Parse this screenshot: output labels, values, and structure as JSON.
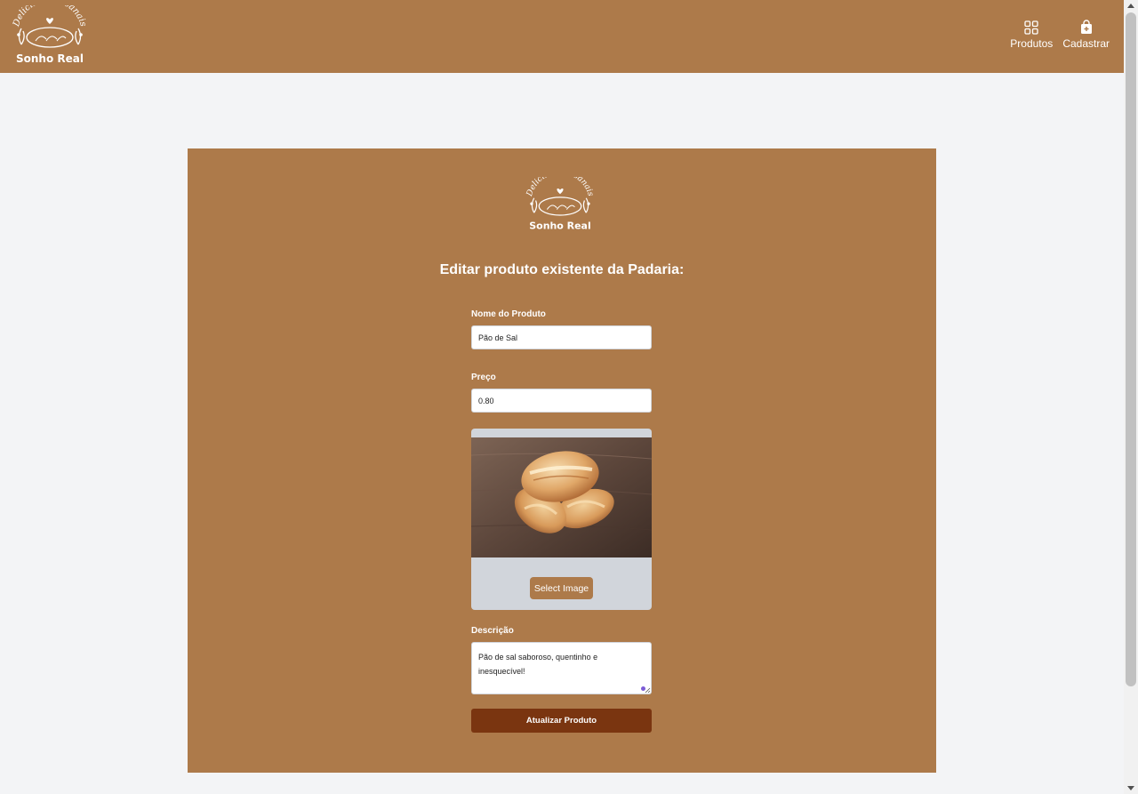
{
  "brand": {
    "arc_text": "Delicias Artesanais",
    "name": "Sonho Real"
  },
  "nav": {
    "items": [
      {
        "label": "Produtos",
        "icon": "grid-icon"
      },
      {
        "label": "Cadastrar",
        "icon": "shopping-bag-plus-icon"
      }
    ]
  },
  "form": {
    "title": "Editar produto existente da Padaria:",
    "name_label": "Nome do Produto",
    "name_value": "Pão de Sal",
    "price_label": "Preço",
    "price_value": "0.80",
    "select_image_label": "Select Image",
    "description_label": "Descrição",
    "description_value": "Pão de sal saboroso, quentinho e inesquecível!",
    "submit_label": "Atualizar Produto"
  },
  "colors": {
    "brand_brown": "#ad7a4a",
    "button_dark": "#7a3510",
    "page_bg": "#f3f4f6",
    "image_box_bg": "#d1d5db"
  }
}
